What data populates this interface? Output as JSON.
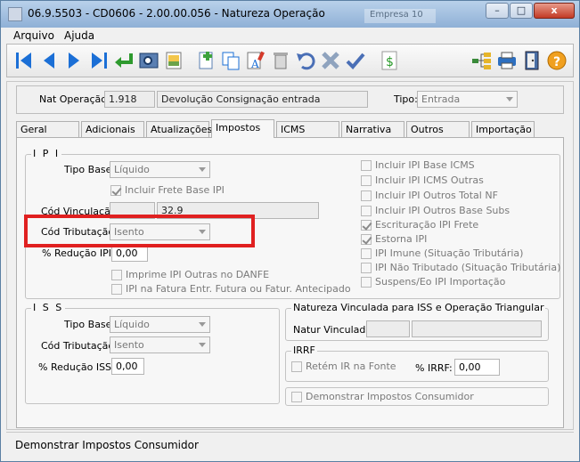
{
  "window": {
    "title": "06.9.5503 - CD0606 - 2.00.00.056 - Natureza Operação",
    "ghost_title": "Empresa 10"
  },
  "title_buttons": {
    "minimize": "–",
    "maximize": "□",
    "close": "x"
  },
  "menu": [
    {
      "label": "Arquivo"
    },
    {
      "label": "Ajuda"
    }
  ],
  "toolbar_icons": [
    "first-record-icon",
    "previous-record-icon",
    "next-record-icon",
    "last-record-icon",
    "return-icon",
    "zoom-icon",
    "notes-icon",
    "new-record-icon",
    "copy-icon",
    "edit-icon",
    "delete-icon",
    "undo-icon",
    "cancel-icon",
    "confirm-icon",
    "dollar-icon",
    "tree-icon",
    "print-icon",
    "exit-icon",
    "help-icon"
  ],
  "header": {
    "nat_label": "Nat Operação:",
    "nat_code": "1.918",
    "nat_desc": "Devolução Consignação entrada",
    "tipo_label": "Tipo:",
    "tipo_value": "Entrada"
  },
  "tabs": [
    "Geral",
    "Adicionais",
    "Atualizações",
    "Impostos",
    "ICMS",
    "Narrativa",
    "Outros",
    "Importação"
  ],
  "active_tab": "Impostos",
  "ipi": {
    "title": "I P I",
    "tipo_base_label": "Tipo Base:",
    "tipo_base_value": "Líquido",
    "incluir_frete": "Incluir Frete Base IPI",
    "cod_vinc_label": "Cód Vinculação:",
    "cod_vinc_value": "",
    "cod_vinc_value2": "32.9",
    "cod_trib_label": "Cód Tributação:",
    "cod_trib_value": "Isento",
    "reducao_label": "% Redução IPI:",
    "reducao_value": "0,00",
    "imprime_outras": "Imprime IPI Outras no DANFE",
    "ipi_fatura": "IPI na Fatura Entr. Futura ou Fatur. Antecipado",
    "right_checks": [
      {
        "label": "Incluir IPI Base ICMS",
        "checked": false
      },
      {
        "label": "Incluir IPI ICMS Outras",
        "checked": false
      },
      {
        "label": "Incluir IPI Outros Total NF",
        "checked": false
      },
      {
        "label": "Incluir IPI Outros Base Subs",
        "checked": false
      },
      {
        "label": "Escrituração IPI Frete",
        "checked": true
      },
      {
        "label": "Estorna IPI",
        "checked": true
      },
      {
        "label": "IPI Imune (Situação Tributária)",
        "checked": false
      },
      {
        "label": "IPI Não Tributado (Situação Tributária)",
        "checked": false
      },
      {
        "label": "Suspens/Eo IPI Importação",
        "checked": false
      }
    ]
  },
  "iss": {
    "title": "I S S",
    "tipo_base_label": "Tipo Base:",
    "tipo_base_value": "Líquido",
    "cod_trib_label": "Cód Tributação:",
    "cod_trib_value": "Isento",
    "reducao_label": "% Redução ISS:",
    "reducao_value": "0,00"
  },
  "natureza_vinc": {
    "title": "Natureza Vinculada para ISS e Operação Triangular",
    "label": "Natur Vinculada:",
    "value": ""
  },
  "irrf": {
    "title": "IRRF",
    "retem": "Retém IR na Fonte",
    "perc_label": "% IRRF:",
    "perc_value": "0,00"
  },
  "demonstrar": "Demonstrar Impostos Consumidor",
  "status": "Demonstrar Impostos Consumidor"
}
